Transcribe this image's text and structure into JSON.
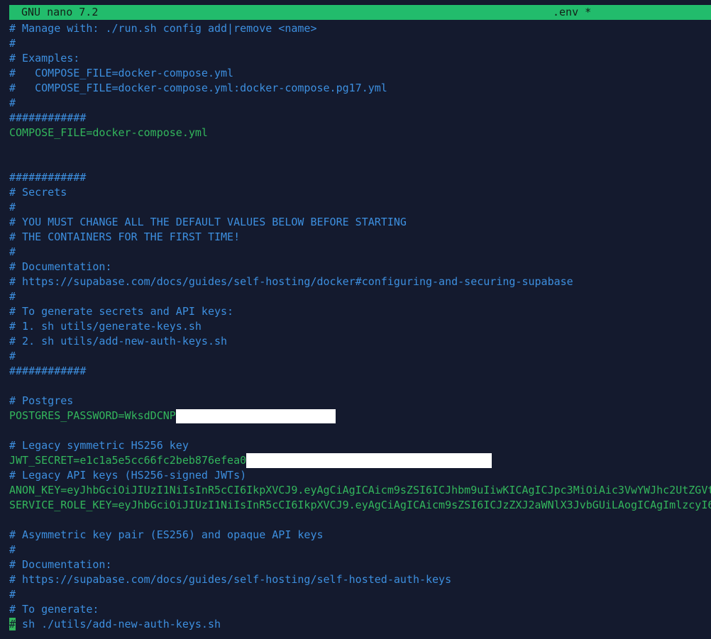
{
  "title_bar": {
    "app": "GNU nano 7.2",
    "file": ".env *"
  },
  "lines": [
    "# Manage with: ./run.sh config add|remove <name>",
    "#",
    "# Examples:",
    "#   COMPOSE_FILE=docker-compose.yml",
    "#   COMPOSE_FILE=docker-compose.yml:docker-compose.pg17.yml",
    "#",
    "############",
    "COMPOSE_FILE=docker-compose.yml",
    "",
    "",
    "############",
    "# Secrets",
    "#",
    "# YOU MUST CHANGE ALL THE DEFAULT VALUES BELOW BEFORE STARTING",
    "# THE CONTAINERS FOR THE FIRST TIME!",
    "#",
    "# Documentation:",
    "# https://supabase.com/docs/guides/self-hosting/docker#configuring-and-securing-supabase",
    "#",
    "# To generate secrets and API keys:",
    "# 1. sh utils/generate-keys.sh",
    "# 2. sh utils/add-new-auth-keys.sh",
    "#",
    "############",
    "",
    "# Postgres",
    "POSTGRES_PASSWORD=WksdDCNPI",
    "",
    "# Legacy symmetric HS256 key",
    "JWT_SECRET=e1c1a5e5cc66fc2beb876efea0a",
    "# Legacy API keys (HS256-signed JWTs)",
    "ANON_KEY=eyJhbGciOiJIUzI1NiIsInR5cCI6IkpXVCJ9.eyAgCiAgICAicm9sZSI6ICJhbm9uIiwKICAgICJpc3MiOiAic3VwYWJhc2UtZGVt",
    "SERVICE_ROLE_KEY=eyJhbGciOiJIUzI1NiIsInR5cCI6IkpXVCJ9.eyAgCiAgICAicm9sZSI6ICJzZXJ2aWNlX3JvbGUiLAogICAgImlzcyI6",
    "",
    "# Asymmetric key pair (ES256) and opaque API keys",
    "#",
    "# Documentation:",
    "# https://supabase.com/docs/guides/self-hosting/self-hosted-auth-keys",
    "#",
    "# To generate:",
    " sh ./utils/add-new-auth-keys.sh"
  ],
  "cursor_char": "#"
}
